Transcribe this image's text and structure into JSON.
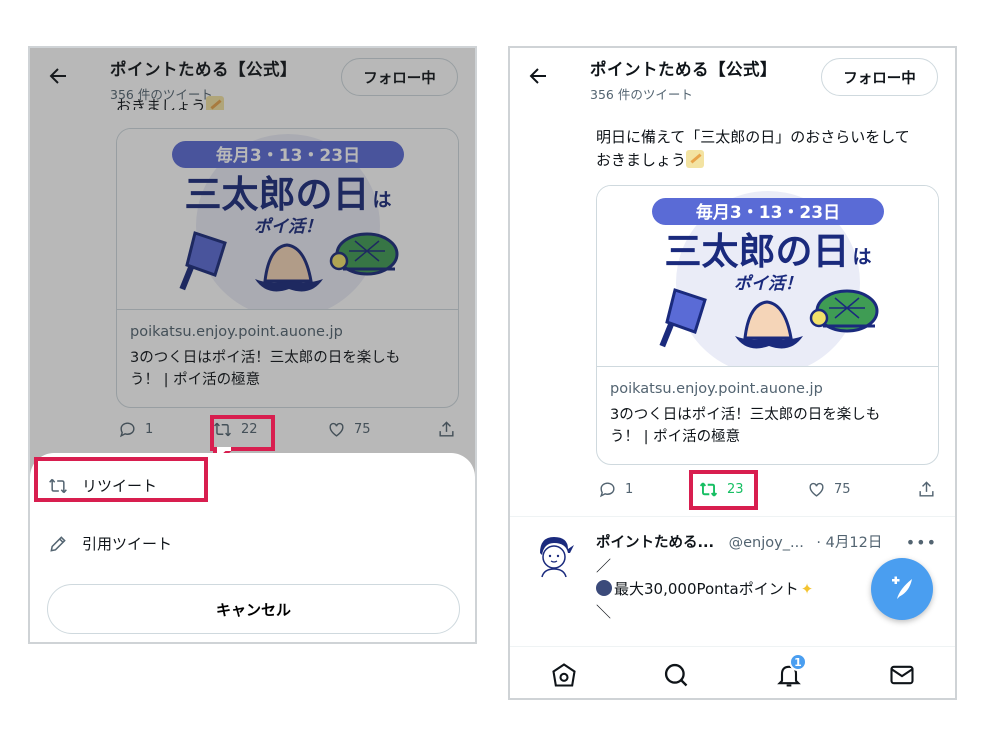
{
  "header": {
    "account_name": "ポイントためる【公式】",
    "tweet_count": "356 件のツイート",
    "follow_label": "フォロー中"
  },
  "tweet": {
    "text_line1": "明日に備えて「三太郎の日」のおさらいをして",
    "text_line2": "おきましょう",
    "text_partial_left": "おきましょう"
  },
  "card": {
    "image_banner": "毎月3・13・23日",
    "image_title_main": "三太郎の日",
    "image_title_suffix": "は",
    "image_subtitle": "ポイ活！",
    "domain": "poikatsu.enjoy.point.auone.jp",
    "title_line1": "3のつく日はポイ活！三太郎の日を楽しも",
    "title_line2": "う！ | ポイ活の極意"
  },
  "left_actions": {
    "replies": "1",
    "retweets": "22",
    "likes": "75"
  },
  "right_actions": {
    "replies": "1",
    "retweets": "23",
    "likes": "75"
  },
  "sheet": {
    "retweet_label": "リツイート",
    "quote_label": "引用ツイート",
    "cancel_label": "キャンセル"
  },
  "reply": {
    "name": "ポイントためる...",
    "handle": "@enjoy_...",
    "date": "· 4月12日",
    "more": "•••",
    "line1": "／",
    "line2": "最大30,000Pontaポイント",
    "line3": "＼"
  },
  "tabbar": {
    "notifications_badge": "1"
  },
  "colors": {
    "highlight": "#d81e4f",
    "retweet_active": "#17bf63",
    "brand_navy": "#1a2a7d",
    "banner_blue": "#5a6bd6",
    "fab_blue": "#4a9ef0"
  }
}
